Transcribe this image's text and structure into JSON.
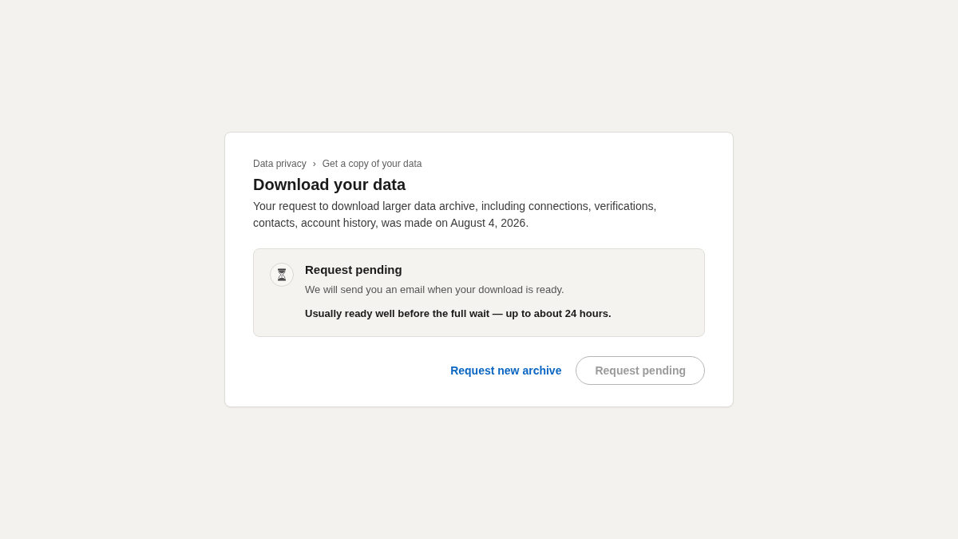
{
  "breadcrumb": {
    "items": [
      {
        "label": "Data privacy"
      },
      {
        "label": "Get a copy of your data"
      }
    ],
    "separator": "›"
  },
  "title": "Download your data",
  "description": "Your request to download larger data archive, including connections, verifications, contacts, account history, was made on August 4, 2026.",
  "notice": {
    "title": "Request pending",
    "message": "We will send you an email when your download is ready.",
    "note": "Usually ready well before the full wait — up to about 24 hours."
  },
  "actions": [
    {
      "kind": "link",
      "label": "Request new archive",
      "disabled": false
    },
    {
      "kind": "button",
      "label": "Request pending",
      "disabled": true
    }
  ]
}
